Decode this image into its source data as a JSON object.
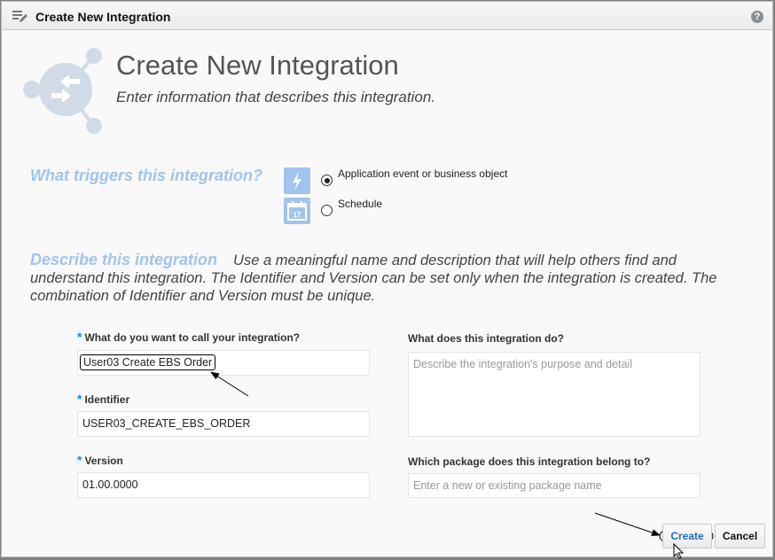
{
  "dialog": {
    "title": "Create New Integration",
    "help": "?"
  },
  "header": {
    "title": "Create New Integration",
    "subtitle": "Enter information that describes this integration."
  },
  "triggers": {
    "heading": "What triggers this integration?",
    "options": [
      {
        "label": "Application event or business object",
        "selected": true,
        "icon": "lightning-icon"
      },
      {
        "label": "Schedule",
        "selected": false,
        "icon": "calendar-icon",
        "icon_text": "17"
      }
    ]
  },
  "describe": {
    "heading": "Describe this integration",
    "text": "Use a meaningful name and description that will help others find and understand this integration. The Identifier and Version can be set only when the integration is created. The combination of Identifier and Version must be unique."
  },
  "form": {
    "name_label": "What do you want to call your integration?",
    "name_value": "User03 Create EBS Order",
    "identifier_label": "Identifier",
    "identifier_value": "USER03_CREATE_EBS_ORDER",
    "version_label": "Version",
    "version_value": "01.00.0000",
    "description_label": "What does this integration do?",
    "description_placeholder": "Describe the integration's purpose and detail",
    "package_label": "Which package does this integration belong to?",
    "package_placeholder": "Enter a new or existing package name",
    "required_mark": "*"
  },
  "buttons": {
    "create": "Create",
    "cancel": "Cancel"
  },
  "colors": {
    "accent": "#a1c4ef",
    "link": "#1e6fc4"
  }
}
